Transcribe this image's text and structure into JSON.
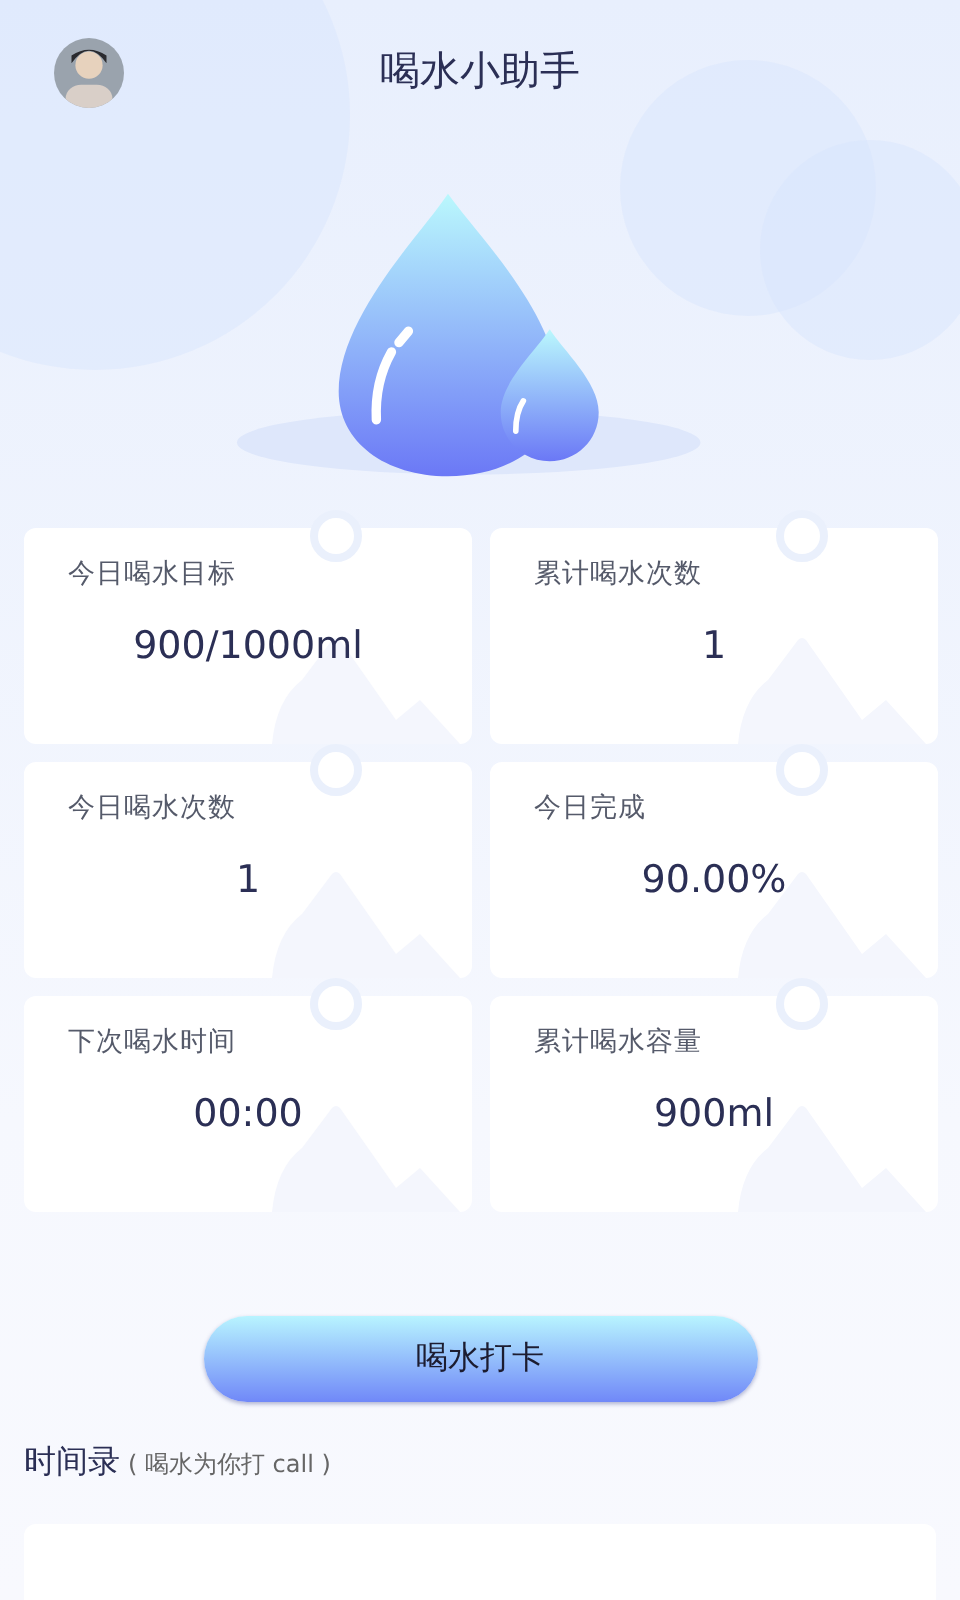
{
  "header": {
    "title": "喝水小助手"
  },
  "stats": [
    {
      "label": "今日喝水目标",
      "value": "900/1000ml"
    },
    {
      "label": "累计喝水次数",
      "value": "1"
    },
    {
      "label": "今日喝水次数",
      "value": "1"
    },
    {
      "label": "今日完成",
      "value": "90.00%"
    },
    {
      "label": "下次喝水时间",
      "value": "00:00"
    },
    {
      "label": "累计喝水容量",
      "value": "900ml"
    }
  ],
  "checkin_button": "喝水打卡",
  "records": {
    "title": "时间录",
    "subtitle": "( 喝水为你打 call )"
  }
}
